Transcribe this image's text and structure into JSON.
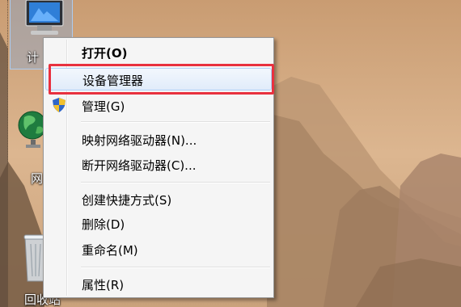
{
  "desktop": {
    "icons": [
      {
        "label": "计",
        "icon": "computer-icon"
      },
      {
        "label": "网",
        "icon": "network-globe-icon"
      },
      {
        "label": "回收站",
        "icon": "recycle-bin-icon"
      }
    ]
  },
  "context_menu": {
    "items": [
      {
        "label": "打开(O)",
        "bold": true
      },
      {
        "label": "设备管理器",
        "hovered": true
      },
      {
        "label": "管理(G)",
        "icon": "uac-shield-icon"
      },
      {
        "label": "映射网络驱动器(N)..."
      },
      {
        "label": "断开网络驱动器(C)..."
      },
      {
        "label": "创建快捷方式(S)"
      },
      {
        "label": "删除(D)"
      },
      {
        "label": "重命名(M)"
      },
      {
        "label": "属性(R)"
      }
    ]
  },
  "colors": {
    "highlight_border": "#e8313f",
    "menu_background": "#f5f5f5",
    "hover_border": "#aecff7"
  }
}
